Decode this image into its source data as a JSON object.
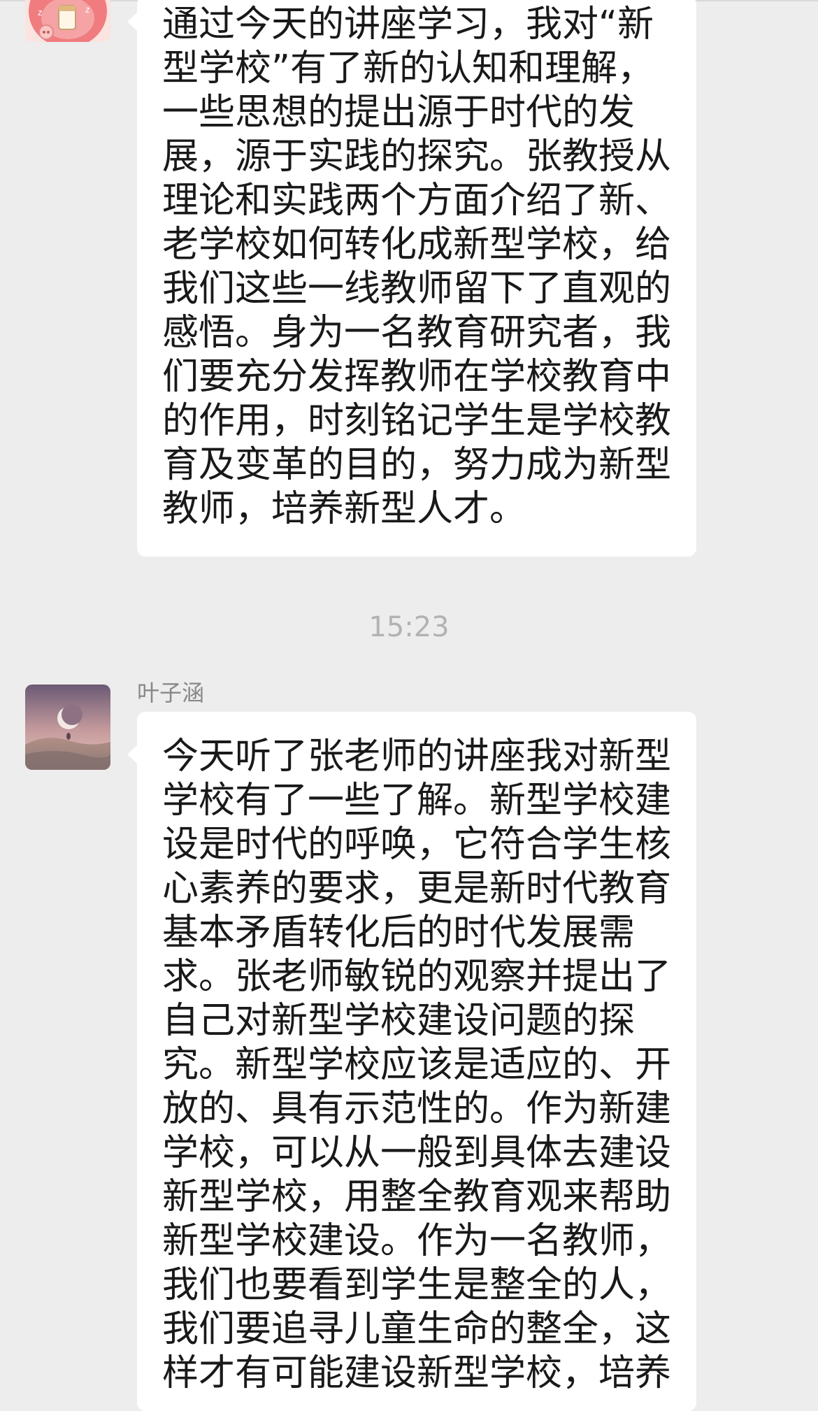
{
  "conversation": {
    "messages": [
      {
        "avatar_icon": "cartoon-pig-avatar",
        "text": "通过今天的讲座学习，我对“新型学校”有了新的认知和理解，一些思想的提出源于时代的发展，源于实践的探究。张教授从理论和实践两个方面介绍了新、老学校如何转化成新型学校，给我们这些一线教师留下了直观的感悟。身为一名教育研究者，我们要充分发挥教师在学校教育中的作用，时刻铭记学生是学校教育及变革的目的，努力成为新型教师，培养新型人才。"
      },
      {
        "timestamp": "15:23",
        "sender": "叶子涵",
        "avatar_icon": "moon-landscape-avatar",
        "text": "今天听了张老师的讲座我对新型学校有了一些了解。新型学校建设是时代的呼唤，它符合学生核心素养的要求，更是新时代教育基本矛盾转化后的时代发展需求。张老师敏锐的观察并提出了自己对新型学校建设问题的探究。新型学校应该是适应的、开放的、具有示范性的。作为新建学校，可以从一般到具体去建设新型学校，用整全教育观来帮助新型学校建设。作为一名教师，我们也要看到学生是整全的人，我们要追寻儿童生命的整全，这样才有可能建设新型学校，培养"
      }
    ]
  },
  "colors": {
    "background": "#ededed",
    "bubble": "#ffffff",
    "message_text": "#191919",
    "timestamp_text": "#b2b2b2",
    "sender_text": "#888888"
  }
}
